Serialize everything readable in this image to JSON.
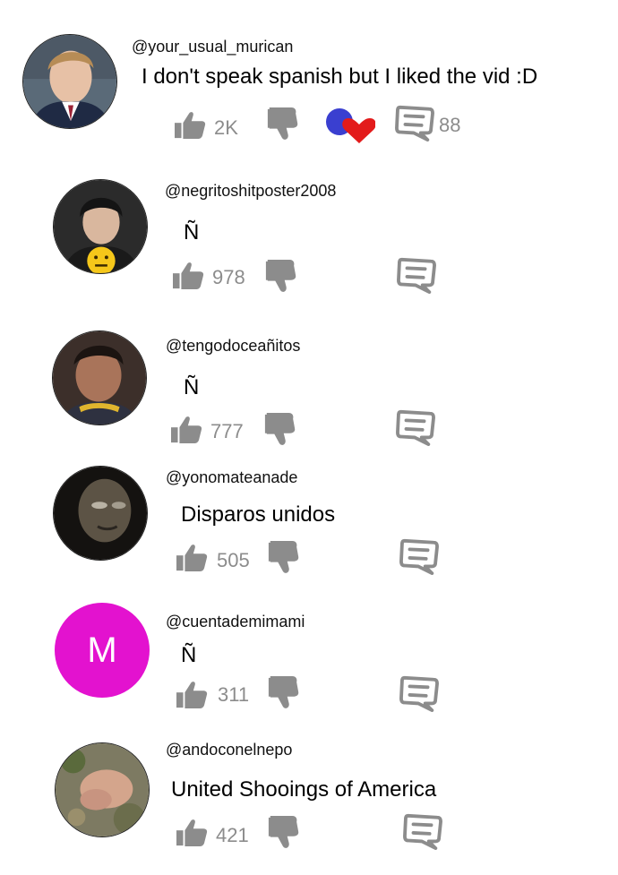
{
  "comments": [
    {
      "username": "@your_usual_murican",
      "text": "I don't speak spanish but I liked the vid :D",
      "likes": "2K",
      "replies": "88",
      "avatar": "photo-blond-man",
      "has_creator_heart": true
    },
    {
      "username": "@negritoshitposter2008",
      "text": "Ñ",
      "likes": "978",
      "replies": "",
      "avatar": "photo-dark-hair-boy-neutral-face-emoji"
    },
    {
      "username": "@tengodoceañitos",
      "text": "Ñ",
      "likes": "777",
      "replies": "",
      "avatar": "photo-young-boy"
    },
    {
      "username": "@yonomateanade",
      "text": "Disparos unidos",
      "likes": "505",
      "replies": "",
      "avatar": "photo-dark-face"
    },
    {
      "username": "@cuentademimami",
      "text": "Ñ",
      "likes": "311",
      "replies": "",
      "avatar_letter": "M",
      "avatar_color": "#e312cf"
    },
    {
      "username": "@andoconelnepo",
      "text": "United Shooings of America",
      "likes": "421",
      "replies": "",
      "avatar": "photo-blurry-ground"
    }
  ],
  "colors": {
    "icon_gray": "#8c8c8c",
    "count_gray": "#8c8c8c",
    "heart_red": "#e31b1b",
    "creator_blue": "#3a3fd0"
  }
}
